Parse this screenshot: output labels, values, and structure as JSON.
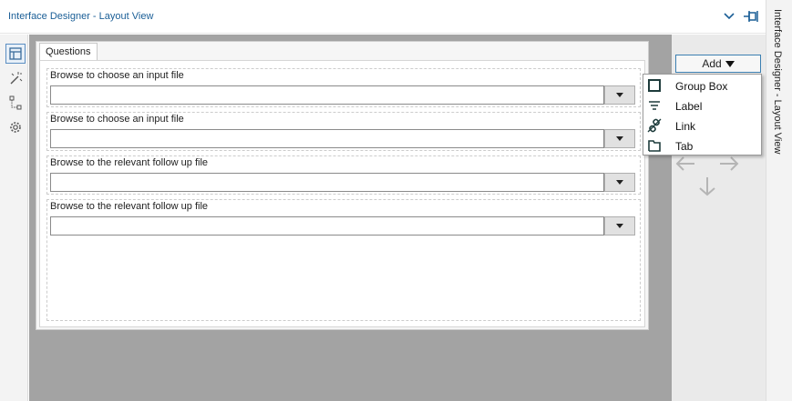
{
  "header": {
    "title": "Interface Designer - Layout View"
  },
  "side_title": "Interface Designer - Layout View",
  "tools": [
    {
      "icon": "layout-icon",
      "active": true
    },
    {
      "icon": "magic-wand-icon",
      "active": false
    },
    {
      "icon": "tree-structure-icon",
      "active": false
    },
    {
      "icon": "gear-icon",
      "active": false
    }
  ],
  "form": {
    "tab_label": "Questions",
    "fields": [
      {
        "label": "Browse to choose an input file",
        "value": ""
      },
      {
        "label": "Browse to choose an input file",
        "value": ""
      },
      {
        "label": "Browse to the relevant follow up file",
        "value": ""
      },
      {
        "label": "Browse to the relevant follow up file",
        "value": ""
      }
    ]
  },
  "add_button": {
    "label": "Add"
  },
  "menu": {
    "items": [
      {
        "label": "Group Box",
        "icon": "group-box-icon"
      },
      {
        "label": "Label",
        "icon": "label-icon"
      },
      {
        "label": "Link",
        "icon": "link-icon"
      },
      {
        "label": "Tab",
        "icon": "tab-icon"
      }
    ]
  },
  "colors": {
    "accent": "#1a5e96",
    "canvas": "#a3a3a3",
    "panel": "#eaeaea"
  }
}
